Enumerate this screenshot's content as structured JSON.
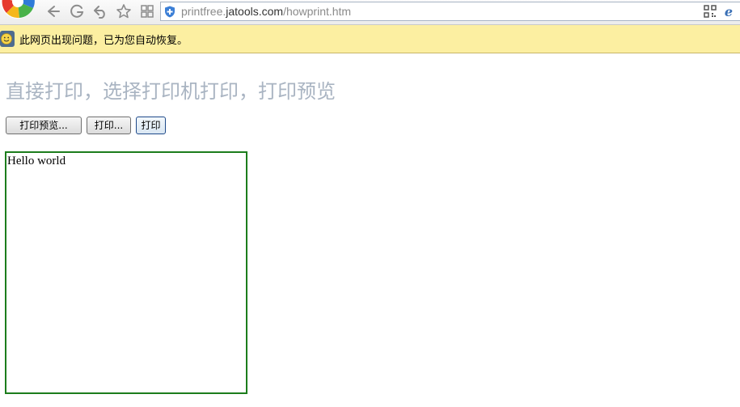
{
  "browser": {
    "url_prefix": "printfree.",
    "url_host": "jatools.com",
    "url_path": "/howprint.htm"
  },
  "infobar": {
    "message": "此网页出现问题，已为您自动恢复。"
  },
  "page": {
    "heading": "直接打印，选择打印机打印，打印预览",
    "buttons": {
      "preview_label": "打印预览...",
      "select_printer_label": "打印...",
      "print_label": "打印"
    },
    "print_area_text": "Hello world"
  },
  "colors": {
    "infobar_bg": "#fcefa1",
    "heading_text": "#a9b4c2",
    "print_area_border": "#1c7d1c",
    "toolbar_bg": "#f2f2f2"
  },
  "icons": [
    "browser-logo-icon",
    "back-icon",
    "refresh-icon",
    "undo-icon",
    "favorite-star-icon",
    "extensions-icon",
    "shield-icon",
    "qrcode-icon",
    "ie-mode-icon",
    "smiley-icon"
  ]
}
